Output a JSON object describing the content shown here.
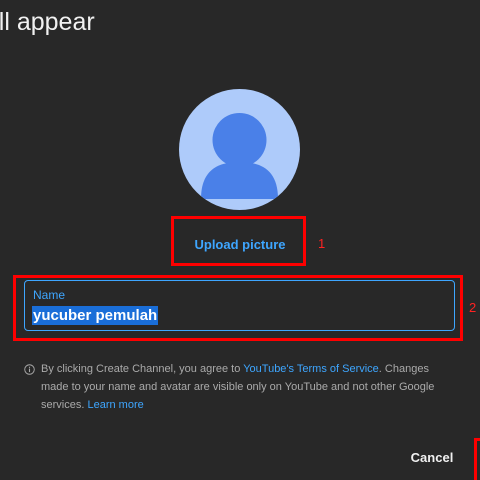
{
  "dialog": {
    "heading": "'ll appear",
    "upload_label": "Upload picture",
    "name_field": {
      "label": "Name",
      "value": "yucuber pemulah"
    },
    "terms": {
      "prefix": "By clicking Create Channel, you agree to ",
      "tos_link": "YouTube's Terms of Service",
      "middle": ". Changes made to your name and avatar are visible only on YouTube and not other Google services. ",
      "learn_more": "Learn more"
    },
    "cancel_label": "Cancel"
  },
  "annotations": {
    "one": "1",
    "two": "2"
  },
  "colors": {
    "background": "#282828",
    "accent": "#3ea6ff",
    "avatar_bg": "#aecbfa",
    "avatar_fg": "#4285f4",
    "annotation": "#ff0000",
    "selection": "#1a6ed8"
  },
  "icons": {
    "avatar": "default-avatar-icon",
    "info": "info-icon"
  }
}
